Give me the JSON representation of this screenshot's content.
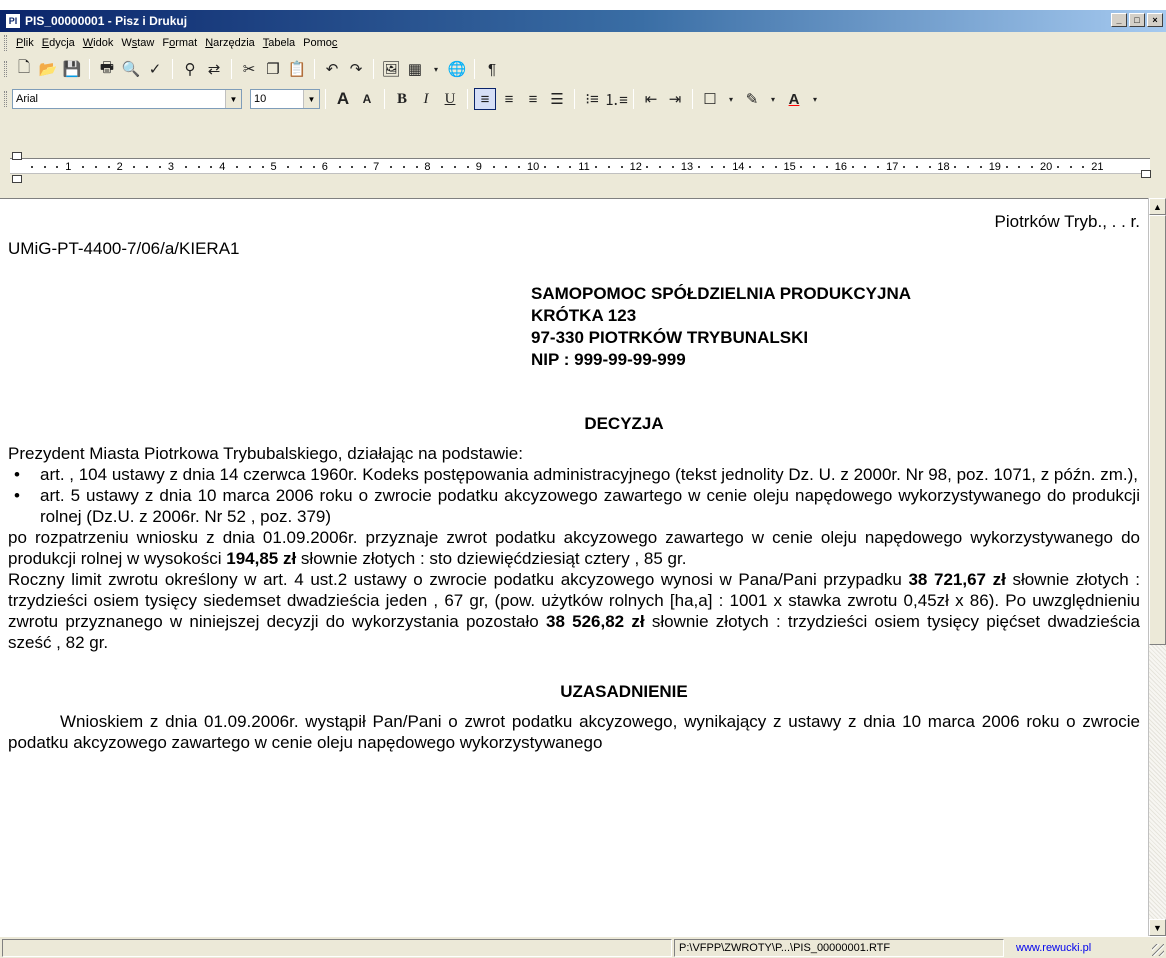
{
  "window": {
    "title": "PIS_00000001 - Pisz i Drukuj",
    "icon_label": "PI",
    "controls": {
      "minimize": "_",
      "maximize": "□",
      "close": "×"
    }
  },
  "menu": [
    {
      "pre": "",
      "u": "P",
      "post": "lik"
    },
    {
      "pre": "",
      "u": "E",
      "post": "dycja"
    },
    {
      "pre": "",
      "u": "W",
      "post": "idok"
    },
    {
      "pre": "W",
      "u": "s",
      "post": "taw"
    },
    {
      "pre": "F",
      "u": "o",
      "post": "rmat"
    },
    {
      "pre": "",
      "u": "N",
      "post": "arzędzia"
    },
    {
      "pre": "",
      "u": "T",
      "post": "abela"
    },
    {
      "pre": "Pomo",
      "u": "c",
      "post": ""
    }
  ],
  "toolbar_standard": [
    "new-icon",
    "open-icon",
    "save-icon",
    "print-icon",
    "print-preview-icon",
    "spellcheck-icon",
    "find-icon",
    "replace-icon",
    "cut-icon",
    "copy-icon",
    "paste-icon",
    "undo-icon",
    "redo-icon",
    "image-icon",
    "table-icon",
    "link-icon",
    "pilcrow-icon"
  ],
  "toolbar_format": {
    "font": "Arial",
    "size": "10",
    "icons": [
      "grow-font-icon",
      "shrink-font-icon",
      "bold-icon",
      "italic-icon",
      "underline-icon",
      "align-left-icon",
      "align-center-icon",
      "align-right-icon",
      "justify-icon",
      "bullet-list-icon",
      "numbered-list-icon",
      "outdent-icon",
      "indent-icon",
      "border-icon",
      "highlight-icon",
      "font-color-icon"
    ]
  },
  "ruler": {
    "labels": [
      "1",
      "2",
      "3",
      "4",
      "5",
      "6",
      "7",
      "8",
      "9",
      "10",
      "11",
      "12",
      "13",
      "14",
      "15",
      "16",
      "17",
      "18",
      "19",
      "20",
      "21"
    ]
  },
  "document": {
    "place_date": "Piotrków Tryb.,   .  .  r.",
    "reference": "UMiG-PT-4400-7/06/a/KIERA1",
    "recipient": [
      "SAMOPOMOC SPÓŁDZIELNIA PRODUKCYJNA",
      "KRÓTKA 123",
      "97-330 PIOTRKÓW TRYBUNALSKI",
      "NIP : 999-99-99-999"
    ],
    "title": "DECYZJA",
    "intro": "Prezydent Miasta Piotrkowa Trybubalskiego, działając na podstawie:",
    "bullets": [
      "art. , 104 ustawy z dnia 14 czerwca 1960r. Kodeks postępowania administracyjnego (tekst jednolity Dz. U. z 2000r. Nr 98, poz. 1071, z późn. zm.),",
      "art. 5 ustawy z dnia 10 marca 2006 roku o zwrocie podatku akcyzowego zawartego w cenie oleju napędowego wykorzystywanego do produkcji rolnej (Dz.U. z 2006r. Nr 52 , poz. 379)"
    ],
    "para1": {
      "a": "po rozpatrzeniu wniosku z dnia 01.09.2006r. przyznaje zwrot podatku akcyzowego zawartego w cenie oleju napędowego wykorzystywanego do produkcji rolnej w wysokości ",
      "b": "194,85 zł",
      "c": " słownie złotych   : sto dziewięćdziesiąt cztery , 85 gr."
    },
    "para2": {
      "a": "Roczny limit zwrotu określony w art. 4 ust.2 ustawy o zwrocie podatku akcyzowego wynosi w Pana/Pani przypadku ",
      "b": "38 721,67 zł",
      "c": " słownie złotych  : trzydzieści osiem tysięcy siedemset dwadzieścia jeden , 67 gr, (pow. użytków rolnych [ha,a] : 1001 x stawka zwrotu 0,45zł x 86). Po uwzględnieniu zwrotu przyznanego w niniejszej decyzji  do wykorzystania pozostało ",
      "d": "38 526,82 zł",
      "e": " słownie złotych  : trzydzieści osiem tysięcy pięćset dwadzieścia sześć , 82 gr."
    },
    "section_title": "UZASADNIENIE",
    "justification": "Wnioskiem z dnia 01.09.2006r. wystąpił Pan/Pani o zwrot podatku akcyzowego, wynikający z ustawy z dnia 10 marca 2006 roku o zwrocie podatku akcyzowego zawartego w cenie oleju napędowego wykorzystywanego"
  },
  "status": {
    "path": "P:\\VFPP\\ZWROTY\\P...\\PIS_00000001.RTF",
    "link": "www.rewucki.pl"
  }
}
